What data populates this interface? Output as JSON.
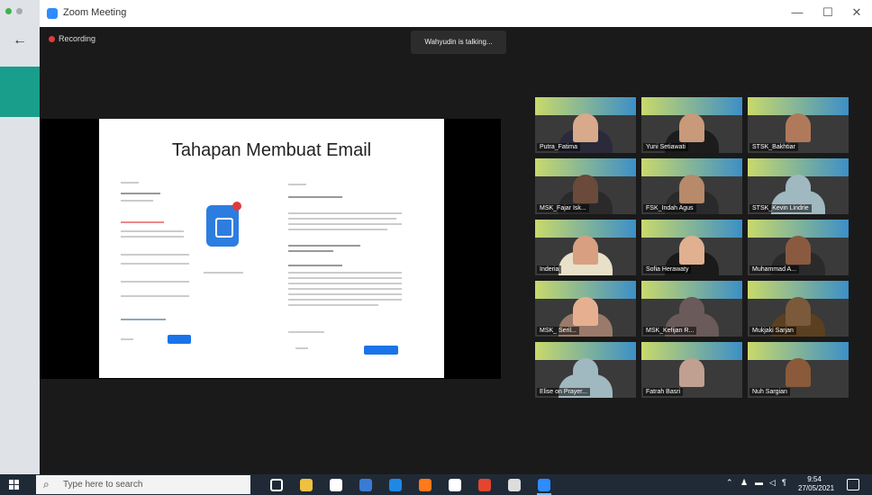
{
  "zoom": {
    "title": "Zoom Meeting",
    "recording_label": "Recording",
    "talking_label": "Wahyudin is talking...",
    "window_controls": {
      "minimize": "—",
      "maximize": "☐",
      "close": "✕"
    }
  },
  "slide": {
    "title": "Tahapan Membuat Email"
  },
  "participants": [
    {
      "name": "Putra_Fatima",
      "face": "#d8a98a",
      "hijab": "#2a2a3a"
    },
    {
      "name": "Yuni Setiawati",
      "face": "#c89a7a",
      "hijab": "#1c1c1c"
    },
    {
      "name": "STSK_Bakhtiar",
      "face": "#b07a5a",
      "hijab": "#3a3a3a"
    },
    {
      "name": "MSK_Fajar Isk...",
      "face": "#6a4a3a",
      "hijab": "#2a2a2a"
    },
    {
      "name": "FSK_Indah Agus",
      "face": "#b78a6a",
      "hijab": "#2a2a2a"
    },
    {
      "name": "STSK_Kevin Lindrie",
      "face": "#a0b8c0",
      "hijab": "#a0b8c0"
    },
    {
      "name": "Inderia",
      "face": "#d8a080",
      "hijab": "#e8e0c8"
    },
    {
      "name": "Sofia Herawaty",
      "face": "#e0b090",
      "hijab": "#1a1a1a"
    },
    {
      "name": "Muhammad A...",
      "face": "#8a5a40",
      "hijab": "#2a2a2a"
    },
    {
      "name": "MSK_ Seril...",
      "face": "#e6b090",
      "hijab": "#9a7a6a"
    },
    {
      "name": "MSK_Kefijan R...",
      "face": "#6a5a5a",
      "hijab": "#6a5a5a"
    },
    {
      "name": "Mukjaki Sarjan",
      "face": "#7a5a3a",
      "hijab": "#5a4020"
    },
    {
      "name": "Elise on Prayer...",
      "face": "#a0b8c0",
      "hijab": "#a0b8c0"
    },
    {
      "name": "Fatrah Basri",
      "face": "#c0a090",
      "hijab": "#3a3a3a"
    },
    {
      "name": "Nuh Sargian",
      "face": "#8a5a3a",
      "hijab": "#3a3a3a"
    }
  ],
  "taskbar": {
    "search_placeholder": "Type here to search",
    "clock_time": "9:54",
    "clock_date": "27/05/2021",
    "apps": [
      {
        "icon": "task-view-icon",
        "color": "#ffffff"
      },
      {
        "icon": "file-explorer-icon",
        "color": "#f0c040"
      },
      {
        "icon": "edge-icon",
        "color": "#ffffff"
      },
      {
        "icon": "store-icon",
        "color": "#3a7bd5"
      },
      {
        "icon": "chrome-edge-icon",
        "color": "#1e88e5"
      },
      {
        "icon": "firefox-icon",
        "color": "#ff7a1a"
      },
      {
        "icon": "paint-icon",
        "color": "#ffffff"
      },
      {
        "icon": "office-icon",
        "color": "#e3452e"
      },
      {
        "icon": "shield-icon",
        "color": "#dddddd"
      },
      {
        "icon": "zoom-icon",
        "color": "#2d8cff"
      }
    ]
  }
}
